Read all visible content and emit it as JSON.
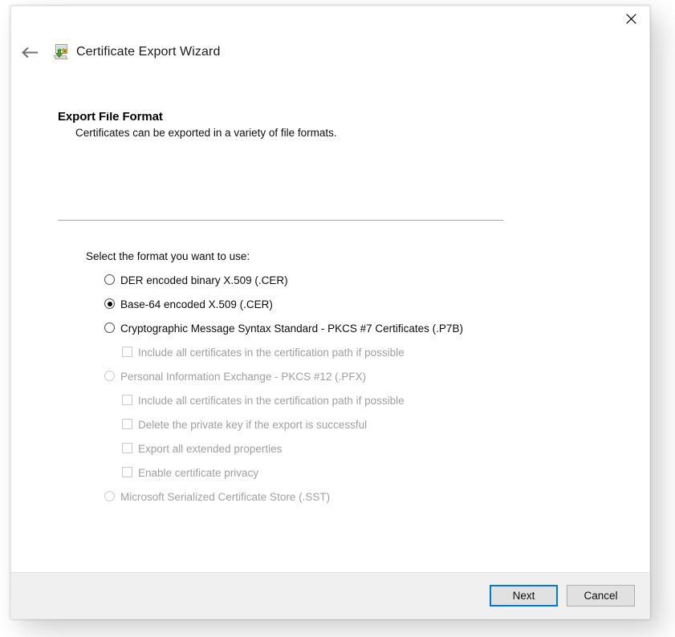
{
  "window": {
    "title": "Certificate Export Wizard",
    "title_icon": "certificate-export-icon",
    "back_icon": "back-arrow-icon",
    "close_icon": "close-icon"
  },
  "page": {
    "title": "Export File Format",
    "subtitle": "Certificates can be exported in a variety of file formats.",
    "prompt": "Select the format you want to use:"
  },
  "options": [
    {
      "type": "radio",
      "label": "DER encoded binary X.509 (.CER)",
      "checked": false,
      "disabled": false,
      "name": "radio-der-encoded-binary"
    },
    {
      "type": "radio",
      "label": "Base-64 encoded X.509 (.CER)",
      "checked": true,
      "disabled": false,
      "name": "radio-base64-encoded"
    },
    {
      "type": "radio",
      "label": "Cryptographic Message Syntax Standard - PKCS #7 Certificates (.P7B)",
      "checked": false,
      "disabled": false,
      "name": "radio-pkcs7-certificates"
    },
    {
      "type": "checkbox",
      "label": "Include all certificates in the certification path if possible",
      "checked": false,
      "disabled": true,
      "name": "checkbox-include-all-certificates-pkcs7"
    },
    {
      "type": "radio",
      "label": "Personal Information Exchange - PKCS #12 (.PFX)",
      "checked": false,
      "disabled": true,
      "name": "radio-pkcs12-pfx"
    },
    {
      "type": "checkbox",
      "label": "Include all certificates in the certification path if possible",
      "checked": false,
      "disabled": true,
      "name": "checkbox-include-all-certificates-pfx"
    },
    {
      "type": "checkbox",
      "label": "Delete the private key if the export is successful",
      "checked": false,
      "disabled": true,
      "name": "checkbox-delete-private-key"
    },
    {
      "type": "checkbox",
      "label": "Export all extended properties",
      "checked": false,
      "disabled": true,
      "name": "checkbox-export-extended-properties"
    },
    {
      "type": "checkbox",
      "label": "Enable certificate privacy",
      "checked": false,
      "disabled": true,
      "name": "checkbox-enable-certificate-privacy"
    },
    {
      "type": "radio",
      "label": "Microsoft Serialized Certificate Store (.SST)",
      "checked": false,
      "disabled": true,
      "name": "radio-serialized-certificate-store"
    }
  ],
  "footer": {
    "next_label": "Next",
    "cancel_label": "Cancel"
  },
  "colors": {
    "accent_focus": "#0078d7",
    "button_face": "#e1e1e1",
    "button_border": "#adadad",
    "footer_bg": "#f0f0f0",
    "divider": "#a0a4a8",
    "text": "#0d0d0d",
    "text_disabled": "#a0a0a0"
  }
}
